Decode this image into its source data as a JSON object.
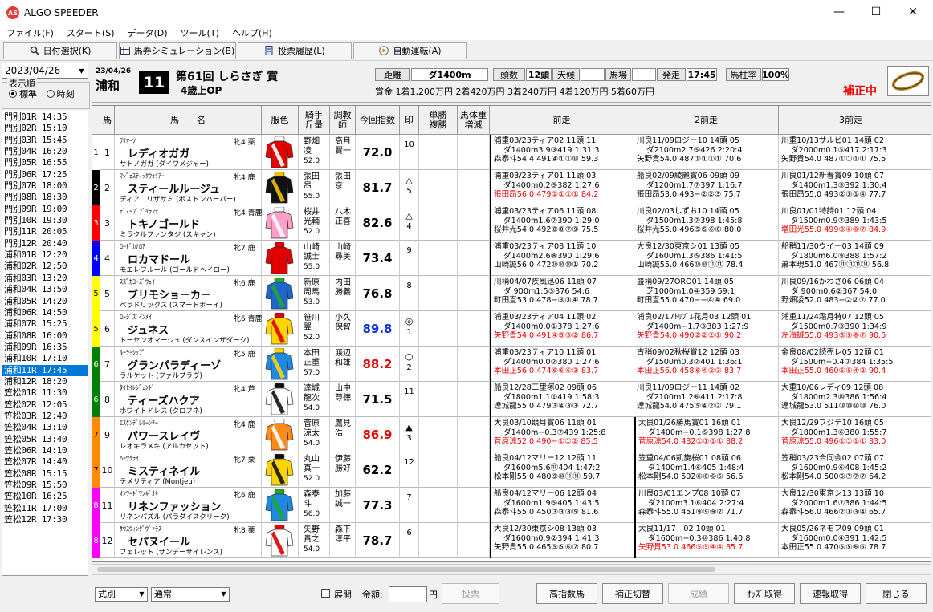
{
  "window": {
    "title": "ALGO SPEEDER",
    "logo": "AS",
    "minimize": "—",
    "maximize": "☐",
    "close": "✕"
  },
  "menu": [
    "ファイル(F)",
    "スタート(S)",
    "データ(D)",
    "ツール(T)",
    "ヘルプ(H)"
  ],
  "toolbar": {
    "date_select": "日付選択(K)",
    "bet_sim": "馬券シミュレーション(B)",
    "bet_history": "投票履歴(L)",
    "auto_run": "自動運転(A)"
  },
  "sidebar": {
    "date": "2023/04/26",
    "order_label": "表示順",
    "order_standard": "標準",
    "order_time": "時刻",
    "races": [
      "門別01R 14:35",
      "門別02R 15:10",
      "門別03R 15:45",
      "門別04R 16:20",
      "門別05R 16:55",
      "門別06R 17:25",
      "門別07R 18:00",
      "門別08R 18:30",
      "門別09R 19:00",
      "門別10R 19:30",
      "門別11R 20:05",
      "門別12R 20:40",
      "浦和01R 12:20",
      "浦和02R 12:50",
      "浦和03R 13:20",
      "浦和04R 13:50",
      "浦和05R 14:20",
      "浦和06R 14:50",
      "浦和07R 15:25",
      "浦和08R 16:00",
      "浦和09R 16:35",
      "浦和10R 17:10",
      "浦和11R 17:45",
      "浦和12R 18:20",
      "笠松01R 11:30",
      "笠松02R 12:05",
      "笠松03R 12:40",
      "笠松04R 13:10",
      "笠松05R 13:40",
      "笠松06R 14:10",
      "笠松07R 14:40",
      "笠松08R 15:15",
      "笠松09R 15:50",
      "笠松10R 16:25",
      "笠松11R 17:00",
      "笠松12R 17:30"
    ],
    "selected_index": 22
  },
  "race": {
    "date": "23/04/26",
    "venue": "浦和",
    "number": "11",
    "name": "第61回 しらさぎ 賞",
    "condition": "4歳上OP",
    "distance_label": "距離",
    "distance": "ダ1400m",
    "heads_label": "頭数",
    "heads": "12頭",
    "weather_label": "天候",
    "weather": "",
    "track_label": "馬場",
    "track": "",
    "start_label": "発走",
    "start": "17:45",
    "pillar_label": "馬柱率",
    "pillar": "100%",
    "prize": "賞金 1着1,200万円  2着420万円  3着240万円  4着120万円  5着60万円",
    "correction": "補正中"
  },
  "grid_headers": {
    "waku": "",
    "umaban": "馬",
    "horse": "馬　　名",
    "silk": "服色",
    "jockey": "騎手\n斤量",
    "trainer": "調教\n師",
    "index": "今回指数",
    "mark": "印",
    "odds": "単勝\n複勝",
    "weight": "馬体重\n増減",
    "past1": "前走",
    "past2": "2前走",
    "past3": "3前走"
  },
  "horses": [
    {
      "waku": "1",
      "num": "1",
      "sire": "ﾌﾘｵｰｿ",
      "sex": "牝4 栗",
      "name": "レディオガガ",
      "dam": "サトノガガ (ダイワメジャー)",
      "jockey": "野畑\n凌",
      "weight": "52.0",
      "trainer": "高月\n賢一",
      "index": "72.0",
      "mark": "",
      "mark_num": "10",
      "wcolor": "#ffffff",
      "wtext": "#000",
      "icolor": "#000",
      "silk": [
        "#e00000",
        "#ffffff"
      ],
      "p1": [
        "浦重03/23ティア02 11頭 11",
        "ダ1400m3.9③419 1:31:3",
        "森泰斗54.4 491④①①⑩ 59.3"
      ],
      "p1c": "#000",
      "p2": [
        "川良11/09ロジー10 14頭 05",
        "ダ2100m2.7⑤426 2:20:4",
        "矢野貴54.0 487①①①① 70.6"
      ],
      "p2c": "#000",
      "p3": [
        "川重10/13サルビ01 14頭 02",
        "ダ2000m0.1⑤417 2:17:3",
        "矢野貴54.0 487①①①① 75.5"
      ],
      "p3c": "#000"
    },
    {
      "waku": "2",
      "num": "2",
      "sire": "ﾏｼﾞｪｽﾃｨｯｸｳｫﾘｱｰ",
      "sex": "牝4 鹿",
      "name": "スティールルージュ",
      "dam": "ディアコリザサミ (ボストンハーバー)",
      "jockey": "張田\n昂",
      "weight": "55.0",
      "trainer": "張田\n京",
      "index": "81.7",
      "mark": "△",
      "mark_num": "5",
      "wcolor": "#000000",
      "wtext": "#fff",
      "icolor": "#000",
      "silk": [
        "#111111",
        "#f0c000"
      ],
      "p1": [
        "浦重03/23ティア01 11頭 03",
        "ダ1400m0.2⑤382 1:27:6",
        "張田昂56.0 479①①①① 84.2"
      ],
      "p1c": "#e00",
      "p2": [
        "船良02/09綾麗賞06 09頭 09",
        "ダ1200m1.7⑦397 1:16:7",
        "張田昂53.0 493−②②③ 75.7"
      ],
      "p2c": "#000",
      "p3": [
        "川良01/12新春賞09 10頭 07",
        "ダ1400m1.3⑤392 1:30:4",
        "張田昂55.0 493②③①④ 77.7"
      ],
      "p3c": "#000"
    },
    {
      "waku": "3",
      "num": "3",
      "sire": "ﾃﾞｨｰﾌﾟﾌﾞﾘﾗﾝﾃ",
      "sex": "牝4 青鹿",
      "name": "トキノゴールド",
      "dam": "ミラクルファンタジ (スキャン)",
      "jockey": "桜井\n光輔",
      "weight": "52.0",
      "trainer": "八木\n正喜",
      "index": "82.6",
      "mark": "△",
      "mark_num": "4",
      "wcolor": "#ff0000",
      "wtext": "#fff",
      "icolor": "#000",
      "silk": [
        "#ff9ec8",
        "#ffffff"
      ],
      "p1": [
        "浦重03/23ティア06 11頭 08",
        "ダ1400m1.6⑦390 1:29:0",
        "桜井光54.0 492⑧⑧⑦⑨ 75.5"
      ],
      "p1c": "#000",
      "p2": [
        "川良02/03しずお10 14頭 05",
        "ダ1500m1.3⑦398 1:45:8",
        "桜井光55.0 496⑤⑤⑥⑥ 80.0"
      ],
      "p2c": "#000",
      "p3": [
        "川良01/01特詩01 12頭 04",
        "ダ1500m0.9⑦389 1:43:5",
        "増田光55.0 499⑧⑥⑧⑦ 84.9"
      ],
      "p3c": "#e00"
    },
    {
      "waku": "4",
      "num": "4",
      "sire": "ﾛｰﾄﾞｶﾅﾛｱ",
      "sex": "牝7 鹿",
      "name": "ロカマドール",
      "dam": "モエレフルール (ゴールドヘイロー)",
      "jockey": "山崎\n誠士",
      "weight": "55.0",
      "trainer": "山崎\n尋美",
      "index": "73.4",
      "mark": "",
      "mark_num": "9",
      "wcolor": "#0000ff",
      "wtext": "#fff",
      "icolor": "#000",
      "silk": [
        "#e00000",
        "#e00000"
      ],
      "p1": [
        "浦重03/23ティア08 11頭 10",
        "ダ1400m2.6⑧390 1:29:6",
        "山崎誠56.0 472⑩⑩⑩① 70.2"
      ],
      "p1c": "#000",
      "p2": [
        "大良12/30東京シ01 13頭 05",
        "ダ1600m1.3⑤386 1:41:5",
        "山崎誠55.0 466⑩⑩⑪⑪ 78.4"
      ],
      "p2c": "#000",
      "p3": [
        "船稍11/30ウイー03 14頭 09",
        "ダ1800m6.0⑨388 1:57:2",
        "蕭本現51.0 467⑪⑪⑪⑪ 56.8"
      ],
      "p3c": "#000"
    },
    {
      "waku": "5",
      "num": "5",
      "sire": "ｽｽﾞｶｺｰｽﾞｳｪｲ",
      "sex": "牝6 鹿",
      "name": "ブリモショーカー",
      "dam": "ベラドリックス (スマートボーイ)",
      "jockey": "新原\n周馬",
      "weight": "53.0",
      "trainer": "内田\n勝義",
      "index": "76.8",
      "mark": "",
      "mark_num": "8",
      "wcolor": "#ffff00",
      "wtext": "#000",
      "icolor": "#000",
      "silk": [
        "#1e66d0",
        "#22aa22"
      ],
      "p1": [
        "川稍04/07疾風迅06 11頭 07",
        "ダ 900m1.5③376 54:6",
        "町田直53.0 478−③③④ 78.7"
      ],
      "p1c": "#000",
      "p2": [
        "盛稍09/27ORO01 14頭 05",
        "芝1000m1.0④359 59:1",
        "町田直55.0 470−−④④ 69.0"
      ],
      "p2c": "#000",
      "p3": [
        "川良09/16かわさ06 06頭 04",
        "ダ 900m0.6②367 54:0",
        "野畑凌52.0 483−②②⑦ 77.0"
      ],
      "p3c": "#000"
    },
    {
      "waku": "5",
      "num": "6",
      "sire": "ﾛｰｼﾞｽﾞｲﾝﾒｲ",
      "sex": "牝6 青鹿",
      "name": "ジュネス",
      "dam": "トーセンオマージュ (ダンスインザダーク)",
      "jockey": "笹川\n翼",
      "weight": "52.0",
      "trainer": "小久\n保智",
      "index": "89.8",
      "mark": "◎",
      "mark_num": "1",
      "wcolor": "#ffff00",
      "wtext": "#000",
      "icolor": "#1030e0",
      "silk": [
        "#ffd400",
        "#e00000"
      ],
      "p1": [
        "浦重03/23ティア04 11頭 02",
        "ダ1400m0.0①378 1:27:6",
        "矢野貴54.0 491④⑤⑤② 86.7"
      ],
      "p1c": "#e00",
      "p2": [
        "浦良02/17ﾄﾘﾌﾟﾙ花月03 12頭 01",
        "ダ1400m−1.7③383 1:27:9",
        "矢野貴54.0 490②②②① 90.2"
      ],
      "p2c": "#e00",
      "p3": [
        "浦重11/24霜月特07 12頭 05",
        "ダ1500m0.7③390 1:34:9",
        "左海誠55.0 493⑤⑤⑧⑦ 90.5"
      ],
      "p3c": "#e00"
    },
    {
      "waku": "6",
      "num": "7",
      "sire": "ﾙｰﾗｰｼｯﾌﾟ",
      "sex": "牝5 鹿",
      "name": "グランパラディーゾ",
      "dam": "ラルケット (ファルブラヴ)",
      "jockey": "本田\n正重",
      "weight": "57.0",
      "trainer": "渡辺\n和雄",
      "index": "88.2",
      "mark": "○",
      "mark_num": "2",
      "wcolor": "#008000",
      "wtext": "#fff",
      "icolor": "#e00",
      "silk": [
        "#1e88e5",
        "#ffd400"
      ],
      "p1": [
        "浦重03/23ティア10 11頭 01",
        "ダ1400m0.0②380 1:27:6",
        "本田正56.0 474⑥⑥⑥③ 83.7"
      ],
      "p1c": "#e00",
      "p2": [
        "古稍09/02秋桜賞12 12頭 03",
        "ダ1500m0.3②401 1:36:1",
        "本田正56.0 458⑥④②③ 83.7"
      ],
      "p2c": "#e00",
      "p3": [
        "金良08/02読売レ05 12頭 01",
        "ダ1500m−0.4⑦384 1:35:5",
        "本田正55.0 460⑤⑤④② 90.4"
      ],
      "p3c": "#e00"
    },
    {
      "waku": "6",
      "num": "8",
      "sire": "ﾀｲｾｲﾚｼﾞｪﾝﾄﾞ",
      "sex": "牝4 芦",
      "name": "ティーズハクア",
      "dam": "ホワイトドレス (クロフネ)",
      "jockey": "達城\n龍次",
      "weight": "54.0",
      "trainer": "山中\n尊徳",
      "index": "71.5",
      "mark": "",
      "mark_num": "11",
      "wcolor": "#008000",
      "wtext": "#fff",
      "icolor": "#000",
      "silk": [
        "#ffffff",
        "#111111"
      ],
      "p1": [
        "船良12/28三里塚02 09頭 06",
        "ダ1800m1.1①419 1:58:3",
        "達城龍55.0 479③④③③ 72.7"
      ],
      "p1c": "#000",
      "p2": [
        "川良11/09ロジー11 14頭 02",
        "ダ2100m1.2⑥411 2:17:8",
        "達城龍54.0 475⑤④②② 79.1"
      ],
      "p2c": "#000",
      "p3": [
        "大重10/06レディ09 12頭 08",
        "ダ1800m2.3⑩386 1:56:4",
        "達城龍53.0 511⑩⑩⑩⑩ 76.0"
      ],
      "p3c": "#000"
    },
    {
      "waku": "7",
      "num": "9",
      "sire": "ｴｽｹﾝﾃﾞﾚﾘｰﾝﾁｰ",
      "sex": "牝4 鹿",
      "name": "パワースレイヴ",
      "dam": "レオキラメキ (アルカセット)",
      "jockey": "菅原\n涼太",
      "weight": "54.0",
      "trainer": "鷹見\n浩",
      "index": "86.9",
      "mark": "▲",
      "mark_num": "3",
      "wcolor": "#ff8c00",
      "wtext": "#000",
      "icolor": "#e00",
      "silk": [
        "#ff8c1a",
        "#ffffff"
      ],
      "p1": [
        "大良03/10競月賞06 11頭 01",
        "ダ1400m−0.3⑦439 1:25:8",
        "菅原涼52.0 490−①①② 85.5"
      ],
      "p1c": "#e00",
      "p2": [
        "大良01/26勝馬賞01 16頭 01",
        "ダ1400m−0.1⑤398 1:27:8",
        "菅原涼54.0 482①①①① 88.2"
      ],
      "p2c": "#e00",
      "p3": [
        "大良12/29フジテ10 16頭 05",
        "ダ1800m1.3⑥380 1:55:7",
        "菅原涼55.0 496①①①① 83.0"
      ],
      "p3c": "#e00"
    },
    {
      "waku": "7",
      "num": "10",
      "sire": "ﾊｰﾂｸﾗｲ",
      "sex": "牝7 栗",
      "name": "ミスティネイル",
      "dam": "テメリティア (Montjeu)",
      "jockey": "丸山\n真一",
      "weight": "52.0",
      "trainer": "伊藤\n勝好",
      "index": "62.2",
      "mark": "",
      "mark_num": "12",
      "wcolor": "#ff8c00",
      "wtext": "#000",
      "icolor": "#000",
      "silk": [
        "#ffd400",
        "#111111"
      ],
      "p1": [
        "船良04/12マリー12 12頭 11",
        "ダ1600m5.6⑪404 1:47:2",
        "松本剛55.0 480⑨⑩⑪⑪ 59.7"
      ],
      "p1c": "#000",
      "p2": [
        "笠重04/06凱旋桜01 08頭 06",
        "ダ1400m1.4⑥405 1:48:4",
        "松本剛54.0 502⑥⑥⑥⑥ 56.6"
      ],
      "p2c": "#000",
      "p3": [
        "笠稍03/23合同会02 07頭 07",
        "ダ1600m0.9⑥408 1:45:2",
        "松本剛54.0 500⑥⑦⑦⑦ 64.2"
      ],
      "p3c": "#000"
    },
    {
      "waku": "8",
      "num": "11",
      "sire": "ｵﾝﾜｰﾄﾞﾜﾝｷﾞｵｷ",
      "sex": "牝6 鹿",
      "name": "リネンファッション",
      "dam": "リネンパズル (パラダイスクリーク)",
      "jockey": "森泰\n斗",
      "weight": "56.0",
      "trainer": "加藤\n誠一",
      "index": "77.3",
      "mark": "",
      "mark_num": "7",
      "wcolor": "#ff00ff",
      "wtext": "#fff",
      "icolor": "#000",
      "silk": [
        "#1e88e5",
        "#22aa22"
      ],
      "p1": [
        "船良04/12マリー06 12頭 04",
        "ダ1600m1.9⑤405 1:43:5",
        "森泰斗55.0 450③③③⑤ 81.6"
      ],
      "p1c": "#000",
      "p2": [
        "川良03/01エンプ08 10頭 07",
        "ダ2100m3.1⑥404 2:27:4",
        "森泰斗55.0 451⑨⑨⑨⑦ 71.7"
      ],
      "p2c": "#000",
      "p3": [
        "大良12/30東京シ13 13頭 10",
        "ダ2000m1.6⑦386 1:44:5",
        "森泰斗56.0 466②③③④ 65.7"
      ],
      "p3c": "#000"
    },
    {
      "waku": "8",
      "num": "12",
      "sire": "ｻｳｽｳｨﾝｸﾞｳﾞｧﾗｽ",
      "sex": "牝8 栗",
      "name": "セパヌイール",
      "dam": "フェレット (サンデーサイレンス)",
      "jockey": "矢野\n貴之",
      "weight": "54.0",
      "trainer": "森下\n淳平",
      "index": "78.7",
      "mark": "",
      "mark_num": "6",
      "wcolor": "#ff00ff",
      "wtext": "#fff",
      "icolor": "#000",
      "silk": [
        "#ffffff",
        "#e00000"
      ],
      "p1": [
        "大良12/30東京シ08 13頭 03",
        "ダ1600m0.9②394 1:41:3",
        "矢野貴55.0 465⑤⑤⑥⑦ 80.7"
      ],
      "p1c": "#000",
      "p2": [
        "大良11/17　02 10頭 01",
        "ダ1600m−0.3⑩386 1:40:8",
        "矢野貴53.0 466⑤⑤④④ 85.7"
      ],
      "p2c": "#e00",
      "p3": [
        "大良05/26ネモフ09 09頭 01",
        "ダ1600m0.0④391 1:42:5",
        "本田正55.0 470⑤⑤⑥⑥ 78.7"
      ],
      "p3c": "#000"
    }
  ],
  "bottom": {
    "type_combo": "式別",
    "kind_combo": "通常",
    "expand": "展開",
    "amount_label": "金額:",
    "yen": "円",
    "vote": "投票",
    "high_index": "高指数馬",
    "correction_toggle": "補正切替",
    "results": "成績",
    "odds": "ｵｯｽﾞ取得",
    "flash": "速報取得",
    "close": "閉じる"
  }
}
